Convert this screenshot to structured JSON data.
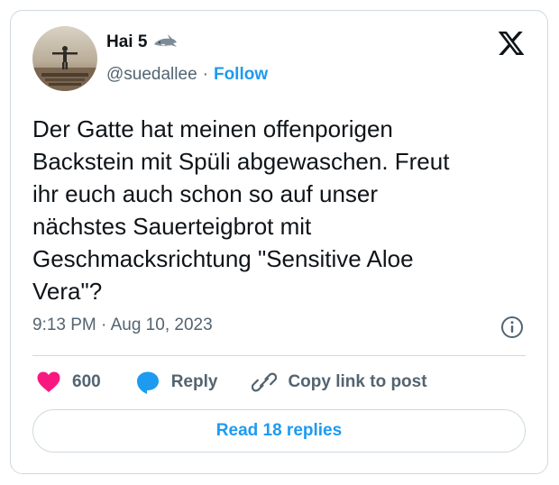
{
  "author": {
    "display_name": "Hai 5",
    "name_emoji_icon": "shark-icon",
    "handle": "@suedallee",
    "separator": "·",
    "follow_label": "Follow"
  },
  "brand_icon": "x-logo-icon",
  "tweet": {
    "text": "Der Gatte hat meinen offenporigen\nBackstein mit Spüli abgewaschen. Freut\nihr euch auch schon so auf unser\nnächstes Sauerteigbrot mit\nGeschmacksrichtung \"Sensitive Aloe\nVera\"?",
    "timestamp": "9:13 PM · Aug 10, 2023"
  },
  "actions": {
    "like_count": "600",
    "reply_label": "Reply",
    "copy_link_label": "Copy link to post"
  },
  "read_replies_label": "Read 18 replies",
  "colors": {
    "accent": "#1d9bf0",
    "like": "#f91880",
    "text": "#0f1419",
    "muted": "#536471",
    "border": "#cfd9de"
  }
}
